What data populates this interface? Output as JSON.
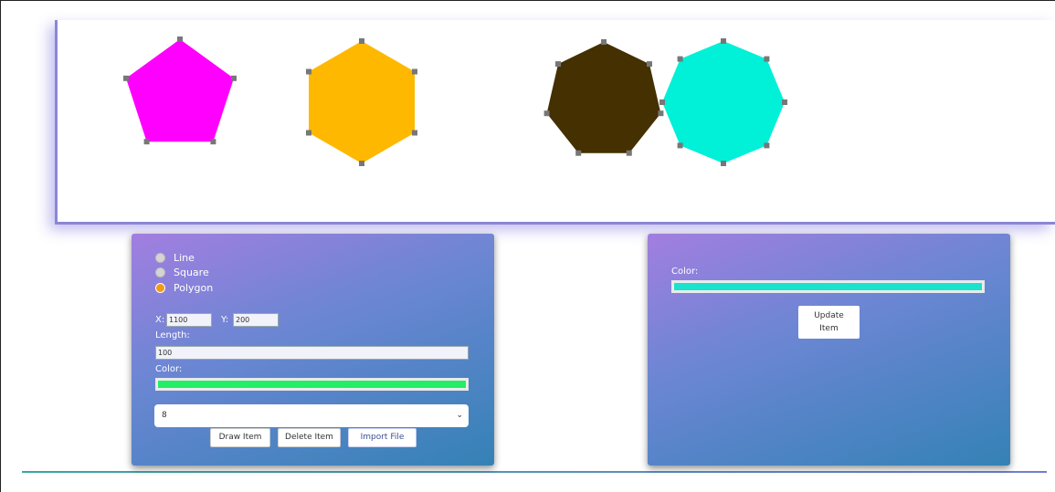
{
  "canvas": {
    "shapes": [
      {
        "name": "pentagon",
        "color": "#ff00ff"
      },
      {
        "name": "hexagon",
        "color": "#ffb800"
      },
      {
        "name": "heptagon",
        "color": "#443000"
      },
      {
        "name": "octagon",
        "color": "#00f0d8"
      }
    ],
    "handle_color": "#777777"
  },
  "left_panel": {
    "shape_options": [
      {
        "label": "Line",
        "checked": false
      },
      {
        "label": "Square",
        "checked": false
      },
      {
        "label": "Polygon",
        "checked": true
      }
    ],
    "x_label": "X:",
    "x_value": "1100",
    "y_label": "Y:",
    "y_value": "200",
    "length_label": "Length:",
    "length_value": "100",
    "color_label": "Color:",
    "color_value": "#22ee66",
    "sides_selected": "8",
    "draw_button": "Draw Item",
    "delete_button": "Delete Item",
    "import_button": "Import File"
  },
  "right_panel": {
    "color_label": "Color:",
    "color_value": "#19e3cd",
    "update_button_line1": "Update",
    "update_button_line2": "Item"
  }
}
